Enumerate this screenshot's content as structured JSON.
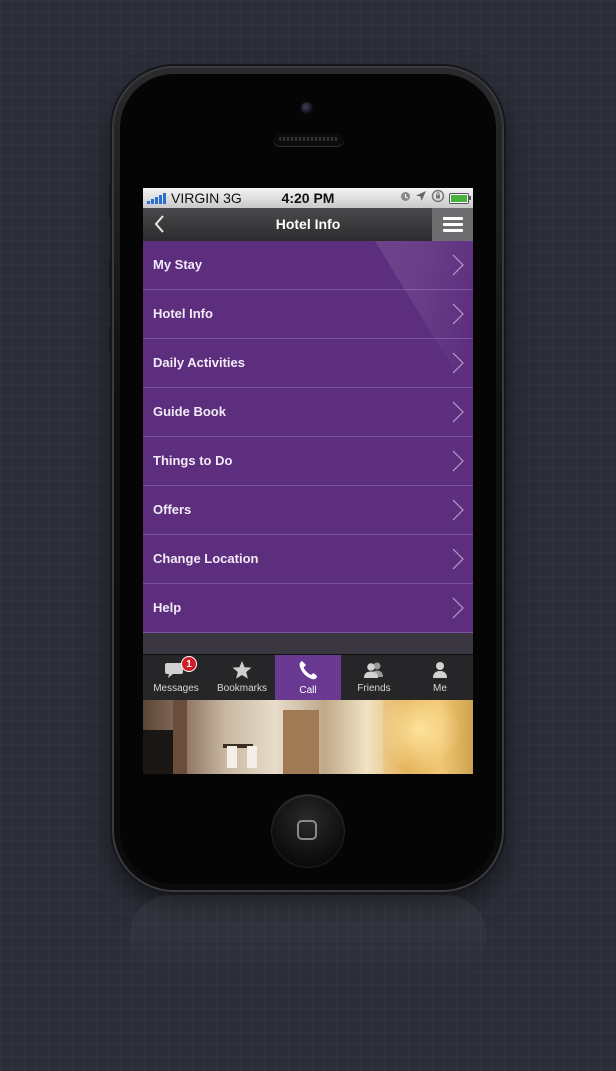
{
  "status_bar": {
    "carrier": "VIRGIN",
    "network": "3G",
    "time": "4:20 PM"
  },
  "nav_bar": {
    "title": "Hotel Info"
  },
  "menu": {
    "items": [
      {
        "label": "My Stay"
      },
      {
        "label": "Hotel Info"
      },
      {
        "label": "Daily Activities"
      },
      {
        "label": "Guide Book"
      },
      {
        "label": "Things to Do"
      },
      {
        "label": "Offers"
      },
      {
        "label": "Change Location"
      },
      {
        "label": "Help"
      }
    ]
  },
  "tab_bar": {
    "tabs": [
      {
        "label": "Messages",
        "icon": "chat-bubble-icon",
        "badge": "1"
      },
      {
        "label": "Bookmarks",
        "icon": "star-icon"
      },
      {
        "label": "Call",
        "icon": "phone-icon",
        "active": true
      },
      {
        "label": "Friends",
        "icon": "friends-icon"
      },
      {
        "label": "Me",
        "icon": "person-icon"
      }
    ]
  },
  "colors": {
    "menu_background": "#5d2e7e",
    "active_tab": "#6a3a93",
    "navbar": "#3a3a3c",
    "badge": "#d11d26"
  }
}
